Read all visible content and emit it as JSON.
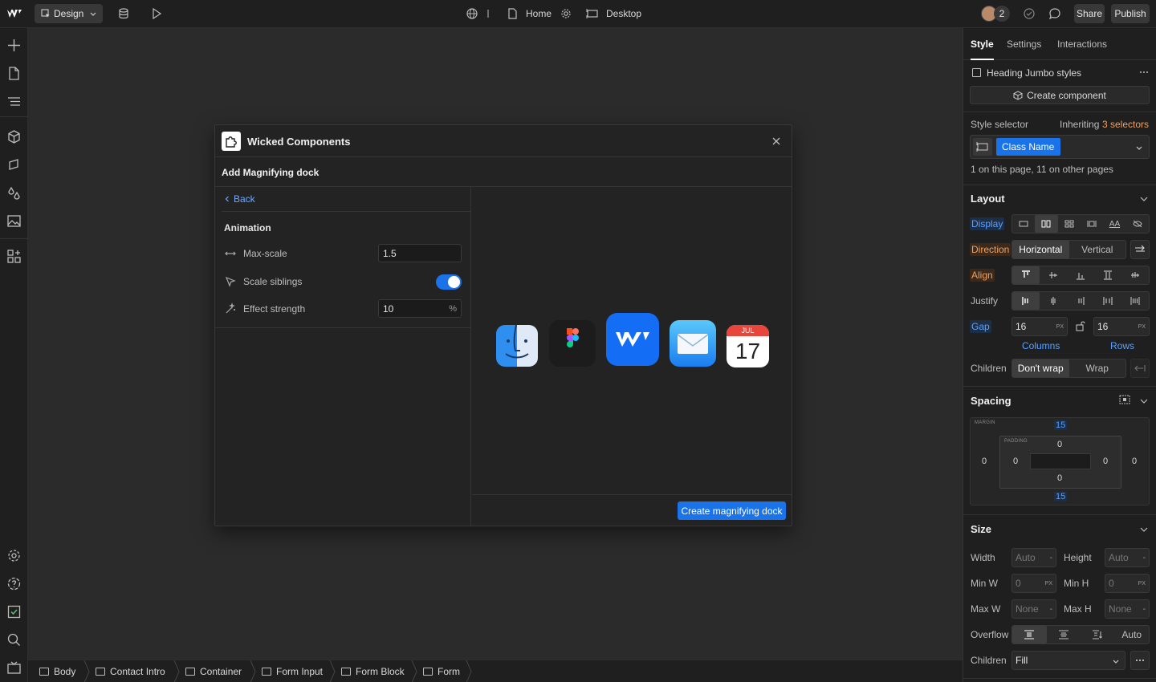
{
  "topbar": {
    "mode_label": "Design",
    "page_name": "Home",
    "breakpoint": "Desktop",
    "collaborator_count": "2",
    "share_label": "Share",
    "publish_label": "Publish"
  },
  "modal": {
    "app_name": "Wicked Components",
    "subtitle": "Add Magnifying dock",
    "back_label": "Back",
    "section_title": "Animation",
    "props": {
      "max_scale_label": "Max-scale",
      "max_scale_value": "1.5",
      "scale_siblings_label": "Scale siblings",
      "scale_siblings_on": true,
      "effect_strength_label": "Effect strength",
      "effect_strength_value": "10",
      "effect_strength_unit": "%"
    },
    "create_button_label": "Create magnifying dock",
    "dock_icons": [
      "finder-icon",
      "figma-icon",
      "webflow-icon",
      "mail-icon",
      "calendar-icon"
    ],
    "calendar": {
      "month": "JUL",
      "day": "17"
    }
  },
  "breadcrumbs": [
    "Body",
    "Contact Intro",
    "Container",
    "Form Input",
    "Form Block",
    "Form"
  ],
  "right_panel": {
    "tabs": [
      "Style",
      "Settings",
      "Interactions"
    ],
    "element_name": "Heading Jumbo styles",
    "create_component_label": "Create component",
    "style_selector_label": "Style selector",
    "inheriting_prefix": "Inheriting",
    "inheriting_link": "3 selectors",
    "class_name": "Class Name",
    "usage_text": "1 on this page, 11 on other pages",
    "layout": {
      "heading": "Layout",
      "display_label": "Display",
      "direction_label": "Direction",
      "direction_options": [
        "Horizontal",
        "Vertical"
      ],
      "align_label": "Align",
      "justify_label": "Justify",
      "gap_label": "Gap",
      "gap_columns": "16",
      "gap_rows": "16",
      "gap_unit": "PX",
      "columns_label": "Columns",
      "rows_label": "Rows",
      "children_label": "Children",
      "wrap_options": [
        "Don't wrap",
        "Wrap"
      ],
      "display_text_option": "AA"
    },
    "spacing": {
      "heading": "Spacing",
      "margin_label": "MARGIN",
      "padding_label": "PADDING",
      "margin_top": "15",
      "margin_bottom": "15",
      "margin_left": "0",
      "margin_right": "0",
      "padding_top": "0",
      "padding_bottom": "0",
      "padding_left": "0",
      "padding_right": "0"
    },
    "size": {
      "heading": "Size",
      "width_label": "Width",
      "width_value": "Auto",
      "height_label": "Height",
      "height_value": "Auto",
      "min_w_label": "Min W",
      "min_w_value": "0",
      "min_h_label": "Min H",
      "min_h_value": "0",
      "max_w_label": "Max W",
      "max_w_value": "None",
      "max_h_label": "Max H",
      "max_h_value": "None",
      "overflow_label": "Overflow",
      "overflow_auto": "Auto",
      "children_label": "Children",
      "children_value": "Fill",
      "unit_px": "PX",
      "unit_dash": "-"
    }
  },
  "colors": {
    "accent": "#1a73e8",
    "canvas": "#2b2b2b",
    "panel": "#1f1f1f"
  }
}
